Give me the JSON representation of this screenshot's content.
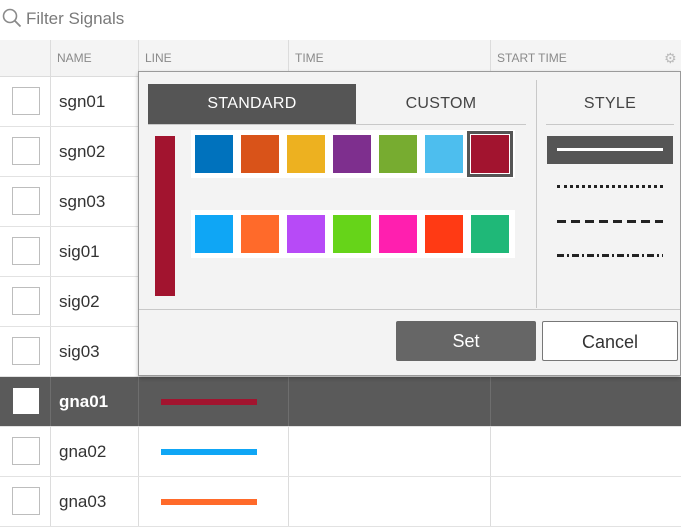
{
  "filter": {
    "placeholder": "Filter Signals",
    "value": ""
  },
  "table": {
    "columns": [
      "NAME",
      "LINE",
      "TIME",
      "START TIME"
    ],
    "rows": [
      {
        "name": "sgn01",
        "color": ""
      },
      {
        "name": "sgn02",
        "color": ""
      },
      {
        "name": "sgn03",
        "color": ""
      },
      {
        "name": "sig01",
        "color": ""
      },
      {
        "name": "sig02",
        "color": ""
      },
      {
        "name": "sig03",
        "color": ""
      },
      {
        "name": "gna01",
        "color": "#A2142F",
        "selected": true
      },
      {
        "name": "gna02",
        "color": "#0FA6F5"
      },
      {
        "name": "gna03",
        "color": "#FF6A2A"
      }
    ]
  },
  "popup": {
    "tabs": {
      "standard": "STANDARD",
      "custom": "CUSTOM",
      "style": "STYLE"
    },
    "active_tab": "STANDARD",
    "current_color": "#A2142F",
    "palette_row1": [
      "#0072BD",
      "#D95319",
      "#EDB120",
      "#7E2F8E",
      "#77AC30",
      "#4DBEEE",
      "#A2142F"
    ],
    "palette_row2": [
      "#0FA6F5",
      "#FF6A2A",
      "#B74AF7",
      "#66D419",
      "#FF1FAF",
      "#FF3A14",
      "#1FB878"
    ],
    "selected_color_index": 6,
    "line_styles": [
      "solid",
      "dotted",
      "dashed",
      "dashdot"
    ],
    "selected_style": "solid",
    "buttons": {
      "set": "Set",
      "cancel": "Cancel"
    }
  },
  "icons": {
    "search": "search-icon",
    "settings": "gear-icon"
  }
}
